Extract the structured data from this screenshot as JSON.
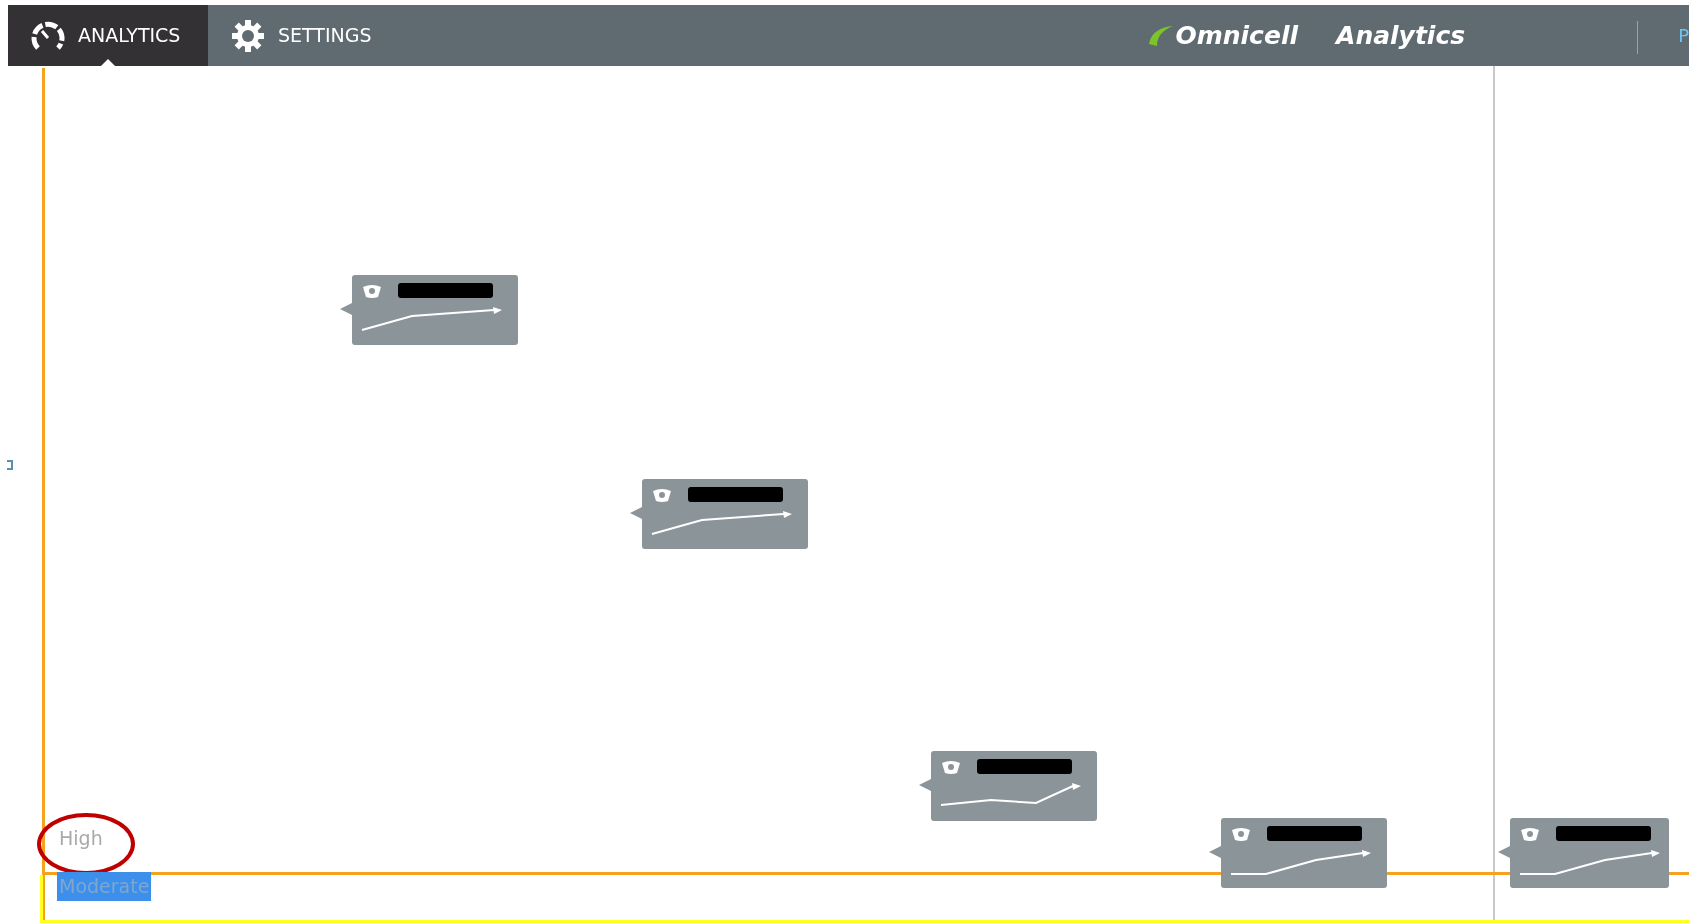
{
  "nav": {
    "tabs": [
      {
        "label": "ANALYTICS",
        "selected": true
      },
      {
        "label": "SETTINGS",
        "selected": false
      }
    ],
    "brand": "Omnicell",
    "product": "Analytics",
    "cut_item": "P"
  },
  "cards": [
    {
      "kind": "plateau",
      "redacted": true
    },
    {
      "kind": "plateau",
      "redacted": true
    },
    {
      "kind": "dip",
      "redacted": true
    },
    {
      "kind": "climb",
      "redacted": true
    },
    {
      "kind": "climb",
      "redacted": true
    }
  ],
  "levels": [
    {
      "label": "High",
      "selected": false,
      "circled": true
    },
    {
      "label": "Moderate",
      "selected": true,
      "circled": false
    }
  ]
}
